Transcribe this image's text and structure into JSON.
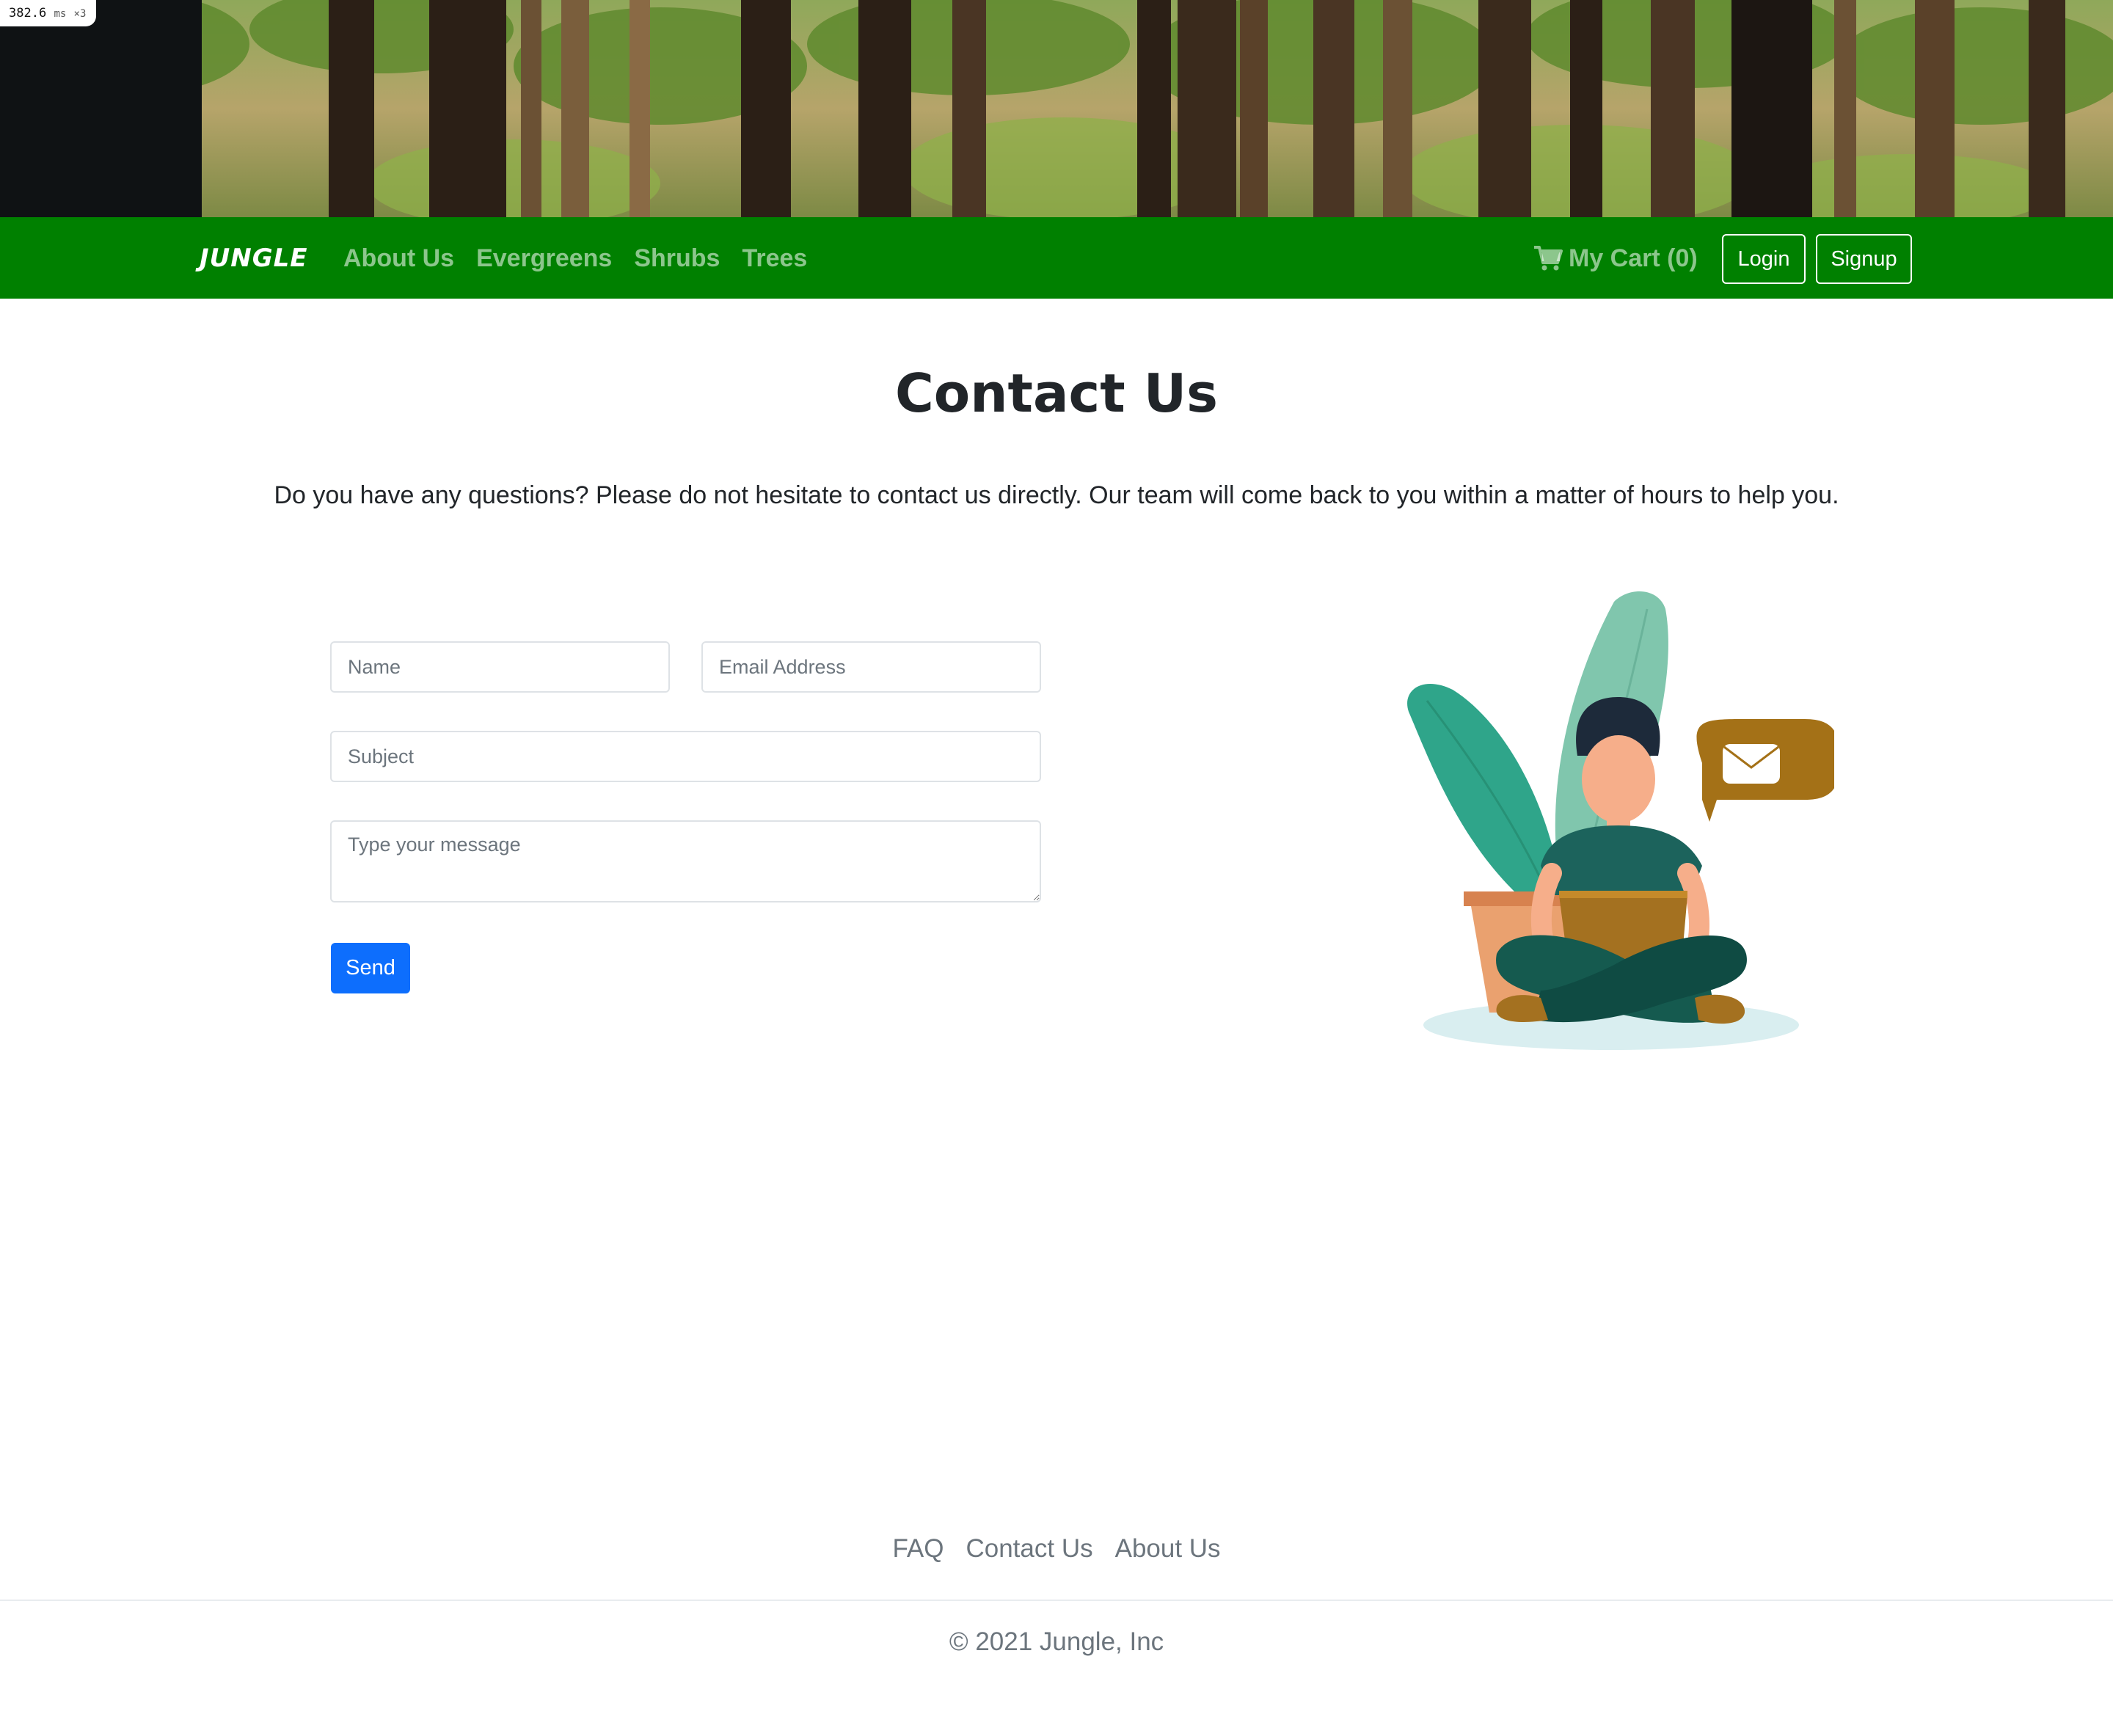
{
  "perf": {
    "value": "382.6",
    "unit": "ms",
    "multiplier": "×3"
  },
  "navbar": {
    "brand": "JUNGLE",
    "links": [
      "About Us",
      "Evergreens",
      "Shrubs",
      "Trees"
    ],
    "cart_label": "My Cart (0)",
    "login_label": "Login",
    "signup_label": "Signup",
    "background_color": "#008000"
  },
  "hero": {
    "image": "forest-banner"
  },
  "main": {
    "title": "Contact Us",
    "intro": "Do you have any questions? Please do not hesitate to contact us directly. Our team will come back to you within a matter of hours to help you.",
    "form": {
      "name_placeholder": "Name",
      "email_placeholder": "Email Address",
      "subject_placeholder": "Subject",
      "message_placeholder": "Type your message",
      "send_label": "Send",
      "send_color": "#0d6efd"
    },
    "illustration": "person-with-laptop-and-plant-illustration"
  },
  "footer": {
    "links": [
      "FAQ",
      "Contact Us",
      "About Us"
    ],
    "copyright": "© 2021 Jungle, Inc"
  },
  "icons": {
    "cart": "cart-icon",
    "mail": "envelope-icon"
  }
}
